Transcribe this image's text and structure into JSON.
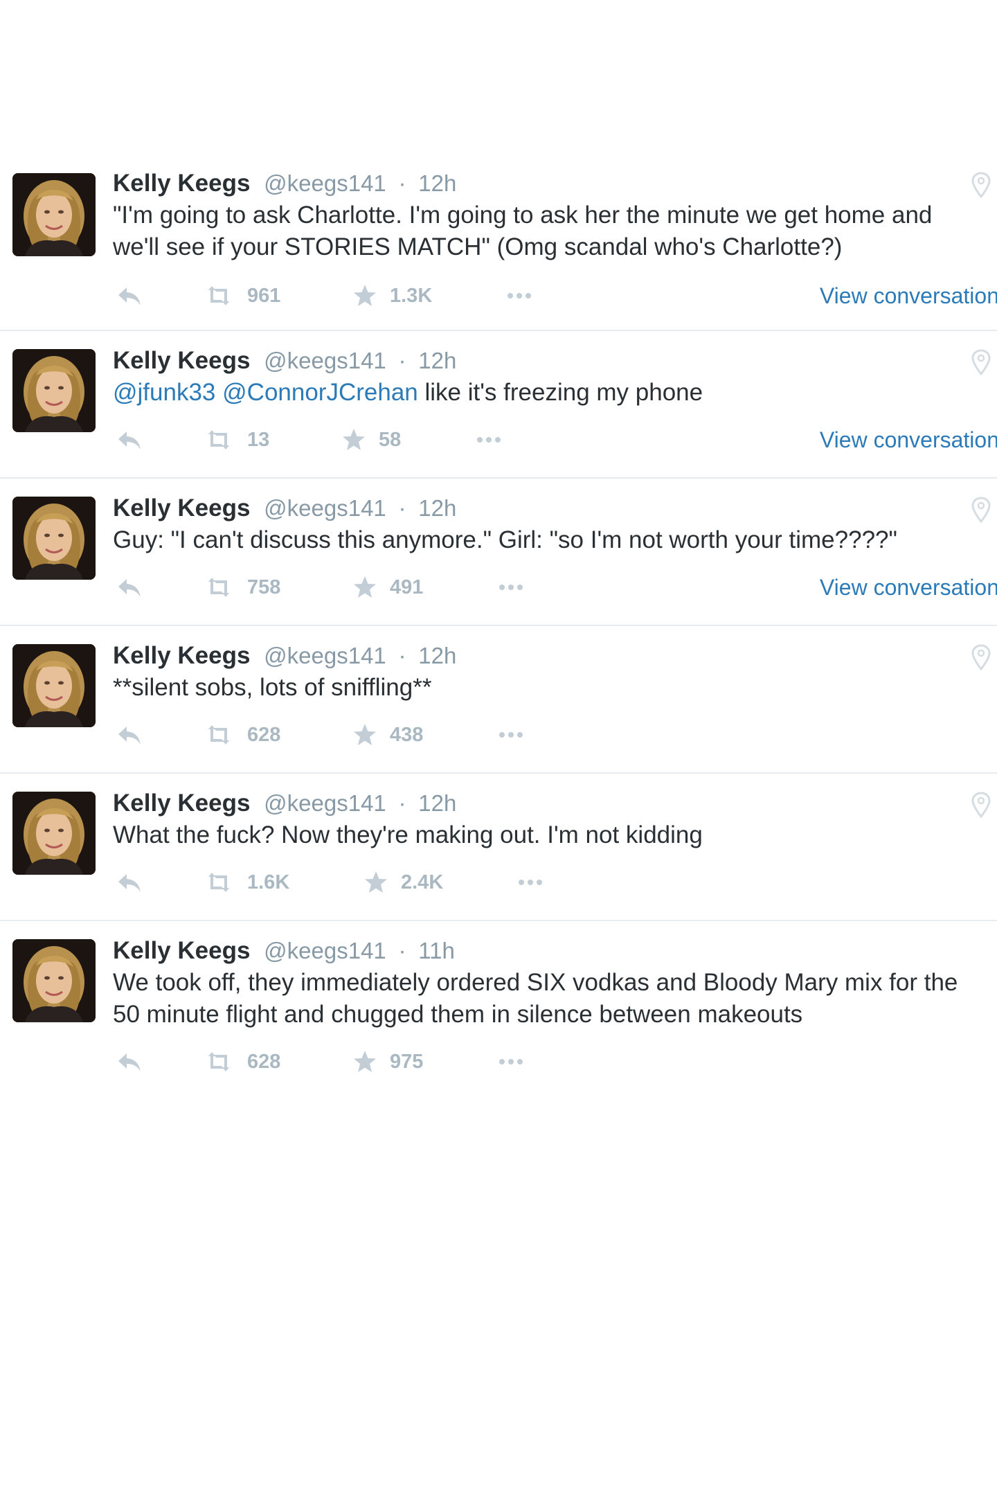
{
  "tweets": [
    {
      "author": "Kelly Keegs",
      "handle": "@keegs141",
      "separator": "·",
      "time": "12h",
      "text": "\"I'm going to ask Charlotte. I'm going to ask her the minute we get home and we'll see if your STORIES MATCH\" (Omg scandal who's Charlotte?)",
      "retweets": "961",
      "favorites": "1.3K",
      "view_conversation": "View conversation"
    },
    {
      "author": "Kelly Keegs",
      "handle": "@keegs141",
      "separator": "·",
      "time": "12h",
      "mention1": "@jfunk33",
      "mention2": "@ConnorJCrehan",
      "text": "like it's freezing my phone",
      "retweets": "13",
      "favorites": "58",
      "view_conversation": "View conversation"
    },
    {
      "author": "Kelly Keegs",
      "handle": "@keegs141",
      "separator": "·",
      "time": "12h",
      "text": "Guy: \"I can't discuss this anymore.\" Girl: \"so I'm not worth your time????\"",
      "retweets": "758",
      "favorites": "491",
      "view_conversation": "View conversation"
    },
    {
      "author": "Kelly Keegs",
      "handle": "@keegs141",
      "separator": "·",
      "time": "12h",
      "text": "**silent sobs, lots of sniffling**",
      "retweets": "628",
      "favorites": "438"
    },
    {
      "author": "Kelly Keegs",
      "handle": "@keegs141",
      "separator": "·",
      "time": "12h",
      "text": "What the fuck? Now they're making out. I'm not kidding",
      "retweets": "1.6K",
      "favorites": "2.4K"
    },
    {
      "author": "Kelly Keegs",
      "handle": "@keegs141",
      "separator": "·",
      "time": "11h",
      "text": "We took off, they immediately ordered SIX vodkas and Bloody Mary mix for the 50 minute flight and chugged them in silence between makeouts",
      "retweets": "628",
      "favorites": "975"
    }
  ],
  "icons": {
    "reply": "reply-icon",
    "retweet": "retweet-icon",
    "favorite": "star-icon",
    "more": "more-dots-icon",
    "location": "location-pin-icon"
  },
  "colors": {
    "link": "#2b7bb9",
    "muted": "#8899a6",
    "action": "#aab8c2",
    "text": "#292f33",
    "divider": "#e6ecf0"
  }
}
